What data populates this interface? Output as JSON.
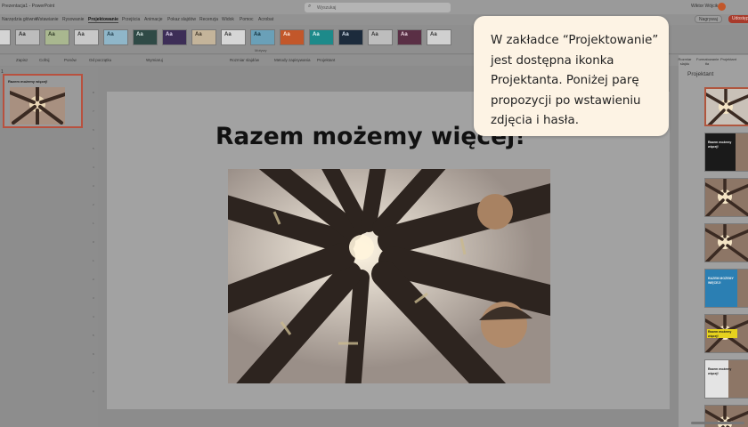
{
  "titlebar": {
    "file_name": "Prezentacja1 - PowerPoint",
    "search_placeholder": "Wyszukaj",
    "user_name": "Wiktor Wójcik"
  },
  "menu": {
    "items": [
      "Narzędzia główne",
      "Wstawianie",
      "Rysowanie",
      "Projektowanie",
      "Przejścia",
      "Animacje",
      "Pokaz slajdów",
      "Recenzja",
      "Widok",
      "Pomoc",
      "Acrobat"
    ],
    "active_index": 3,
    "share_label": "Nagrywaj",
    "red_label": "Udostępnij"
  },
  "ribbon": {
    "themes": [
      {
        "label": "Aa",
        "bg": "#d4d4d4",
        "fg": "#333333"
      },
      {
        "label": "Aa",
        "bg": "#bcbcbc",
        "fg": "#2a2a2a"
      },
      {
        "label": "Aa",
        "bg": "#a9b78f",
        "fg": "#2f3a25"
      },
      {
        "label": "Aa",
        "bg": "#c8c8c8",
        "fg": "#333333"
      },
      {
        "label": "Aa",
        "bg": "#8fb6c9",
        "fg": "#1f3a48"
      },
      {
        "label": "Aa",
        "bg": "#2f4a46",
        "fg": "#d8e6e3"
      },
      {
        "label": "Aa",
        "bg": "#3d2e57",
        "fg": "#e0d6f0"
      },
      {
        "label": "Aa",
        "bg": "#c4b49a",
        "fg": "#3b3226"
      },
      {
        "label": "Aa",
        "bg": "#d6d6d6",
        "fg": "#333333"
      },
      {
        "label": "Aa",
        "bg": "#6aa0b8",
        "fg": "#10303d"
      },
      {
        "label": "Aa",
        "bg": "#c2572a",
        "fg": "#fde9dd"
      },
      {
        "label": "Aa",
        "bg": "#1d8a8a",
        "fg": "#e2f5f5"
      },
      {
        "label": "Aa",
        "bg": "#1c2b3c",
        "fg": "#d6e1ee"
      },
      {
        "label": "Aa",
        "bg": "#bdbdbd",
        "fg": "#333333"
      },
      {
        "label": "Aa",
        "bg": "#5a2f45",
        "fg": "#f0dbe6"
      },
      {
        "label": "Aa",
        "bg": "#d0d0d0",
        "fg": "#333333"
      }
    ],
    "group_label": "Motywy"
  },
  "quickbar": {
    "items": [
      "Zapisz",
      "Cofnij",
      "Ponów",
      "Od początku",
      "Wymiaruj",
      "Rozmiar slajdów",
      "Metody zapisywania",
      "Projektant"
    ]
  },
  "slides_panel": {
    "slide_number": "1",
    "thumb_title": "Razem możemy więcej!"
  },
  "ruler_ticks": [
    "8",
    "7",
    "6",
    "5",
    "4",
    "3",
    "2",
    "1",
    "0",
    "1",
    "2",
    "3",
    "4",
    "5",
    "6",
    "7",
    "8"
  ],
  "slide": {
    "title": "Razem możemy więcej!"
  },
  "right_panel": {
    "buttons": [
      "Rozmiar slajdu",
      "Formatowanie tła",
      "Projektant"
    ],
    "title": "Projektant",
    "designs": [
      {
        "style": "photo-light"
      },
      {
        "style": "dark",
        "text": "Razem możemy więcej!"
      },
      {
        "style": "photo"
      },
      {
        "style": "photo"
      },
      {
        "style": "blue",
        "text": "RAZEM MOŻEMY WIĘCEJ!"
      },
      {
        "style": "yellow",
        "text": "Razem możemy więcej!"
      },
      {
        "style": "split",
        "text": "Razem możemy więcej!"
      },
      {
        "style": "photo"
      }
    ]
  },
  "callout": {
    "text": "W zakładce “Projektowanie” jest dostępna ikonka Projektanta. Poniżej parę propozycji po wstawieniu zdjęcia i hasła."
  }
}
